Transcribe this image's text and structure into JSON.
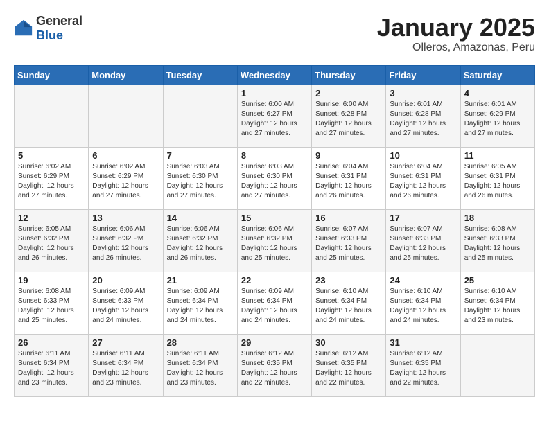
{
  "logo": {
    "general": "General",
    "blue": "Blue"
  },
  "header": {
    "title": "January 2025",
    "subtitle": "Olleros, Amazonas, Peru"
  },
  "days_of_week": [
    "Sunday",
    "Monday",
    "Tuesday",
    "Wednesday",
    "Thursday",
    "Friday",
    "Saturday"
  ],
  "weeks": [
    [
      {
        "day": "",
        "sunrise": "",
        "sunset": "",
        "daylight": ""
      },
      {
        "day": "",
        "sunrise": "",
        "sunset": "",
        "daylight": ""
      },
      {
        "day": "",
        "sunrise": "",
        "sunset": "",
        "daylight": ""
      },
      {
        "day": "1",
        "sunrise": "Sunrise: 6:00 AM",
        "sunset": "Sunset: 6:27 PM",
        "daylight": "Daylight: 12 hours and 27 minutes."
      },
      {
        "day": "2",
        "sunrise": "Sunrise: 6:00 AM",
        "sunset": "Sunset: 6:28 PM",
        "daylight": "Daylight: 12 hours and 27 minutes."
      },
      {
        "day": "3",
        "sunrise": "Sunrise: 6:01 AM",
        "sunset": "Sunset: 6:28 PM",
        "daylight": "Daylight: 12 hours and 27 minutes."
      },
      {
        "day": "4",
        "sunrise": "Sunrise: 6:01 AM",
        "sunset": "Sunset: 6:29 PM",
        "daylight": "Daylight: 12 hours and 27 minutes."
      }
    ],
    [
      {
        "day": "5",
        "sunrise": "Sunrise: 6:02 AM",
        "sunset": "Sunset: 6:29 PM",
        "daylight": "Daylight: 12 hours and 27 minutes."
      },
      {
        "day": "6",
        "sunrise": "Sunrise: 6:02 AM",
        "sunset": "Sunset: 6:29 PM",
        "daylight": "Daylight: 12 hours and 27 minutes."
      },
      {
        "day": "7",
        "sunrise": "Sunrise: 6:03 AM",
        "sunset": "Sunset: 6:30 PM",
        "daylight": "Daylight: 12 hours and 27 minutes."
      },
      {
        "day": "8",
        "sunrise": "Sunrise: 6:03 AM",
        "sunset": "Sunset: 6:30 PM",
        "daylight": "Daylight: 12 hours and 27 minutes."
      },
      {
        "day": "9",
        "sunrise": "Sunrise: 6:04 AM",
        "sunset": "Sunset: 6:31 PM",
        "daylight": "Daylight: 12 hours and 26 minutes."
      },
      {
        "day": "10",
        "sunrise": "Sunrise: 6:04 AM",
        "sunset": "Sunset: 6:31 PM",
        "daylight": "Daylight: 12 hours and 26 minutes."
      },
      {
        "day": "11",
        "sunrise": "Sunrise: 6:05 AM",
        "sunset": "Sunset: 6:31 PM",
        "daylight": "Daylight: 12 hours and 26 minutes."
      }
    ],
    [
      {
        "day": "12",
        "sunrise": "Sunrise: 6:05 AM",
        "sunset": "Sunset: 6:32 PM",
        "daylight": "Daylight: 12 hours and 26 minutes."
      },
      {
        "day": "13",
        "sunrise": "Sunrise: 6:06 AM",
        "sunset": "Sunset: 6:32 PM",
        "daylight": "Daylight: 12 hours and 26 minutes."
      },
      {
        "day": "14",
        "sunrise": "Sunrise: 6:06 AM",
        "sunset": "Sunset: 6:32 PM",
        "daylight": "Daylight: 12 hours and 26 minutes."
      },
      {
        "day": "15",
        "sunrise": "Sunrise: 6:06 AM",
        "sunset": "Sunset: 6:32 PM",
        "daylight": "Daylight: 12 hours and 25 minutes."
      },
      {
        "day": "16",
        "sunrise": "Sunrise: 6:07 AM",
        "sunset": "Sunset: 6:33 PM",
        "daylight": "Daylight: 12 hours and 25 minutes."
      },
      {
        "day": "17",
        "sunrise": "Sunrise: 6:07 AM",
        "sunset": "Sunset: 6:33 PM",
        "daylight": "Daylight: 12 hours and 25 minutes."
      },
      {
        "day": "18",
        "sunrise": "Sunrise: 6:08 AM",
        "sunset": "Sunset: 6:33 PM",
        "daylight": "Daylight: 12 hours and 25 minutes."
      }
    ],
    [
      {
        "day": "19",
        "sunrise": "Sunrise: 6:08 AM",
        "sunset": "Sunset: 6:33 PM",
        "daylight": "Daylight: 12 hours and 25 minutes."
      },
      {
        "day": "20",
        "sunrise": "Sunrise: 6:09 AM",
        "sunset": "Sunset: 6:33 PM",
        "daylight": "Daylight: 12 hours and 24 minutes."
      },
      {
        "day": "21",
        "sunrise": "Sunrise: 6:09 AM",
        "sunset": "Sunset: 6:34 PM",
        "daylight": "Daylight: 12 hours and 24 minutes."
      },
      {
        "day": "22",
        "sunrise": "Sunrise: 6:09 AM",
        "sunset": "Sunset: 6:34 PM",
        "daylight": "Daylight: 12 hours and 24 minutes."
      },
      {
        "day": "23",
        "sunrise": "Sunrise: 6:10 AM",
        "sunset": "Sunset: 6:34 PM",
        "daylight": "Daylight: 12 hours and 24 minutes."
      },
      {
        "day": "24",
        "sunrise": "Sunrise: 6:10 AM",
        "sunset": "Sunset: 6:34 PM",
        "daylight": "Daylight: 12 hours and 24 minutes."
      },
      {
        "day": "25",
        "sunrise": "Sunrise: 6:10 AM",
        "sunset": "Sunset: 6:34 PM",
        "daylight": "Daylight: 12 hours and 23 minutes."
      }
    ],
    [
      {
        "day": "26",
        "sunrise": "Sunrise: 6:11 AM",
        "sunset": "Sunset: 6:34 PM",
        "daylight": "Daylight: 12 hours and 23 minutes."
      },
      {
        "day": "27",
        "sunrise": "Sunrise: 6:11 AM",
        "sunset": "Sunset: 6:34 PM",
        "daylight": "Daylight: 12 hours and 23 minutes."
      },
      {
        "day": "28",
        "sunrise": "Sunrise: 6:11 AM",
        "sunset": "Sunset: 6:34 PM",
        "daylight": "Daylight: 12 hours and 23 minutes."
      },
      {
        "day": "29",
        "sunrise": "Sunrise: 6:12 AM",
        "sunset": "Sunset: 6:35 PM",
        "daylight": "Daylight: 12 hours and 22 minutes."
      },
      {
        "day": "30",
        "sunrise": "Sunrise: 6:12 AM",
        "sunset": "Sunset: 6:35 PM",
        "daylight": "Daylight: 12 hours and 22 minutes."
      },
      {
        "day": "31",
        "sunrise": "Sunrise: 6:12 AM",
        "sunset": "Sunset: 6:35 PM",
        "daylight": "Daylight: 12 hours and 22 minutes."
      },
      {
        "day": "",
        "sunrise": "",
        "sunset": "",
        "daylight": ""
      }
    ]
  ]
}
